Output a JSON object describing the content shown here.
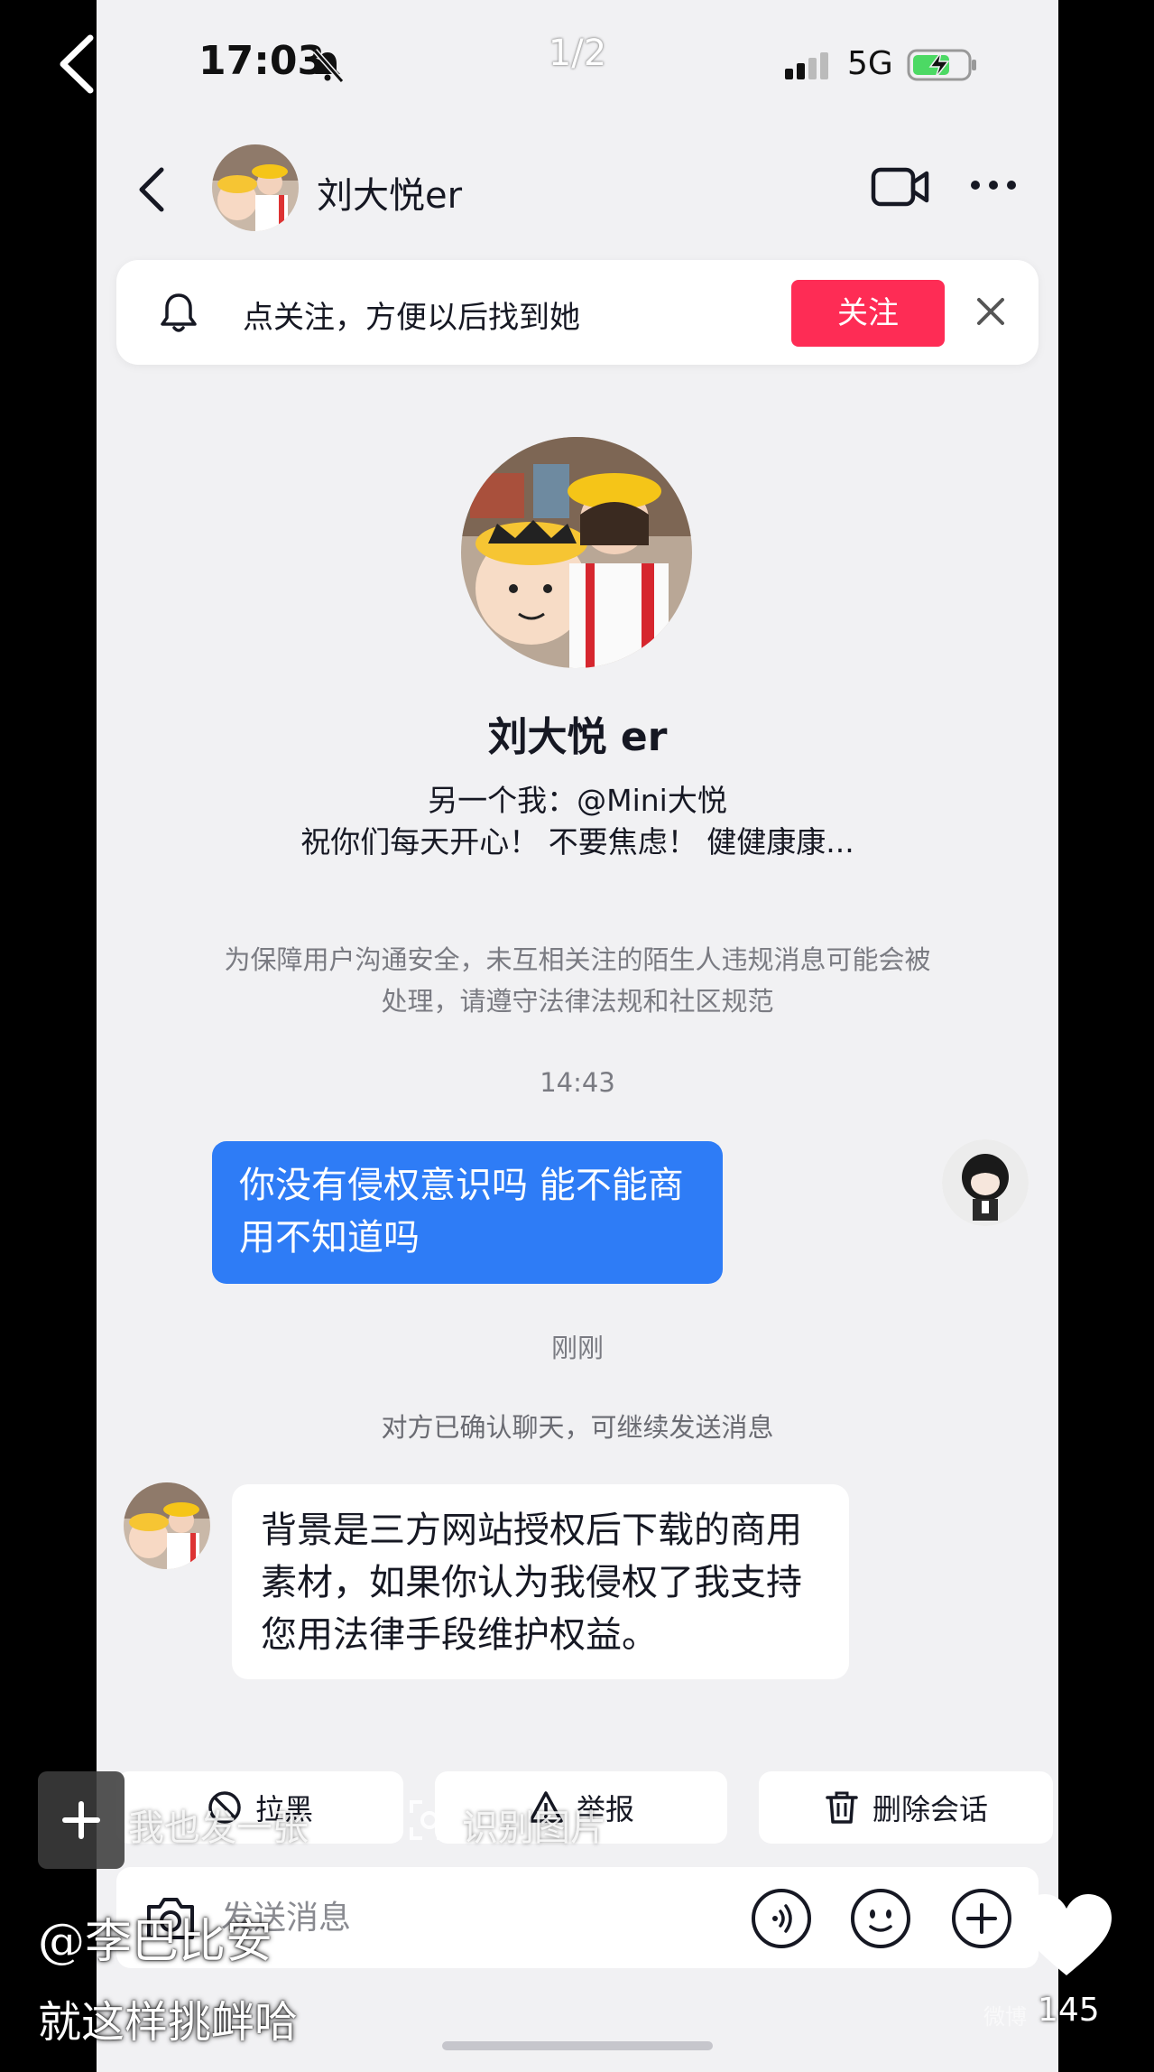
{
  "status_bar": {
    "time": "17:03",
    "page_counter": "1/2",
    "network": "5G",
    "icons": [
      "bell-slash-icon",
      "signal-icon",
      "battery-charging-icon"
    ]
  },
  "header": {
    "title": "刘大悦er",
    "icons": [
      "back-icon",
      "video-call-icon",
      "more-icon"
    ]
  },
  "follow_banner": {
    "hint": "点关注，方便以后找到她",
    "button_label": "关注",
    "accent_color": "#fe2c55"
  },
  "profile": {
    "name": "刘大悦 er",
    "alt_account": "另一个我：@Mini大悦",
    "bio": "祝你们每天开心！ 不要焦虑！ 健健康康..."
  },
  "safety_notice": "为保障用户沟通安全，未互相关注的陌生人违规消息可能会被处理，请遵守法律法规和社区规范",
  "messages": [
    {
      "timestamp": "14:43",
      "direction": "outgoing",
      "text": "你没有侵权意识吗 能不能商用不知道吗"
    },
    {
      "timestamp": "刚刚",
      "system_note": "对方已确认聊天，可继续发送消息",
      "direction": "incoming",
      "text": "背景是三方网站授权后下载的商用素材，如果你认为我侵权了我支持您用法律手段维护权益。"
    }
  ],
  "actions": {
    "block_label": "拉黑",
    "report_label": "举报",
    "delete_label": "删除会话"
  },
  "input": {
    "placeholder": "发送消息"
  },
  "overlay": {
    "toolbar_text_1": "我也发一张",
    "toolbar_text_2": "识别图片",
    "handle": "@李巴比安",
    "caption": "就这样挑衅哈",
    "like_count": "145",
    "watermark": "微博"
  },
  "colors": {
    "outgoing_bubble": "#2e7cf6",
    "background": "#f1f1f3"
  }
}
